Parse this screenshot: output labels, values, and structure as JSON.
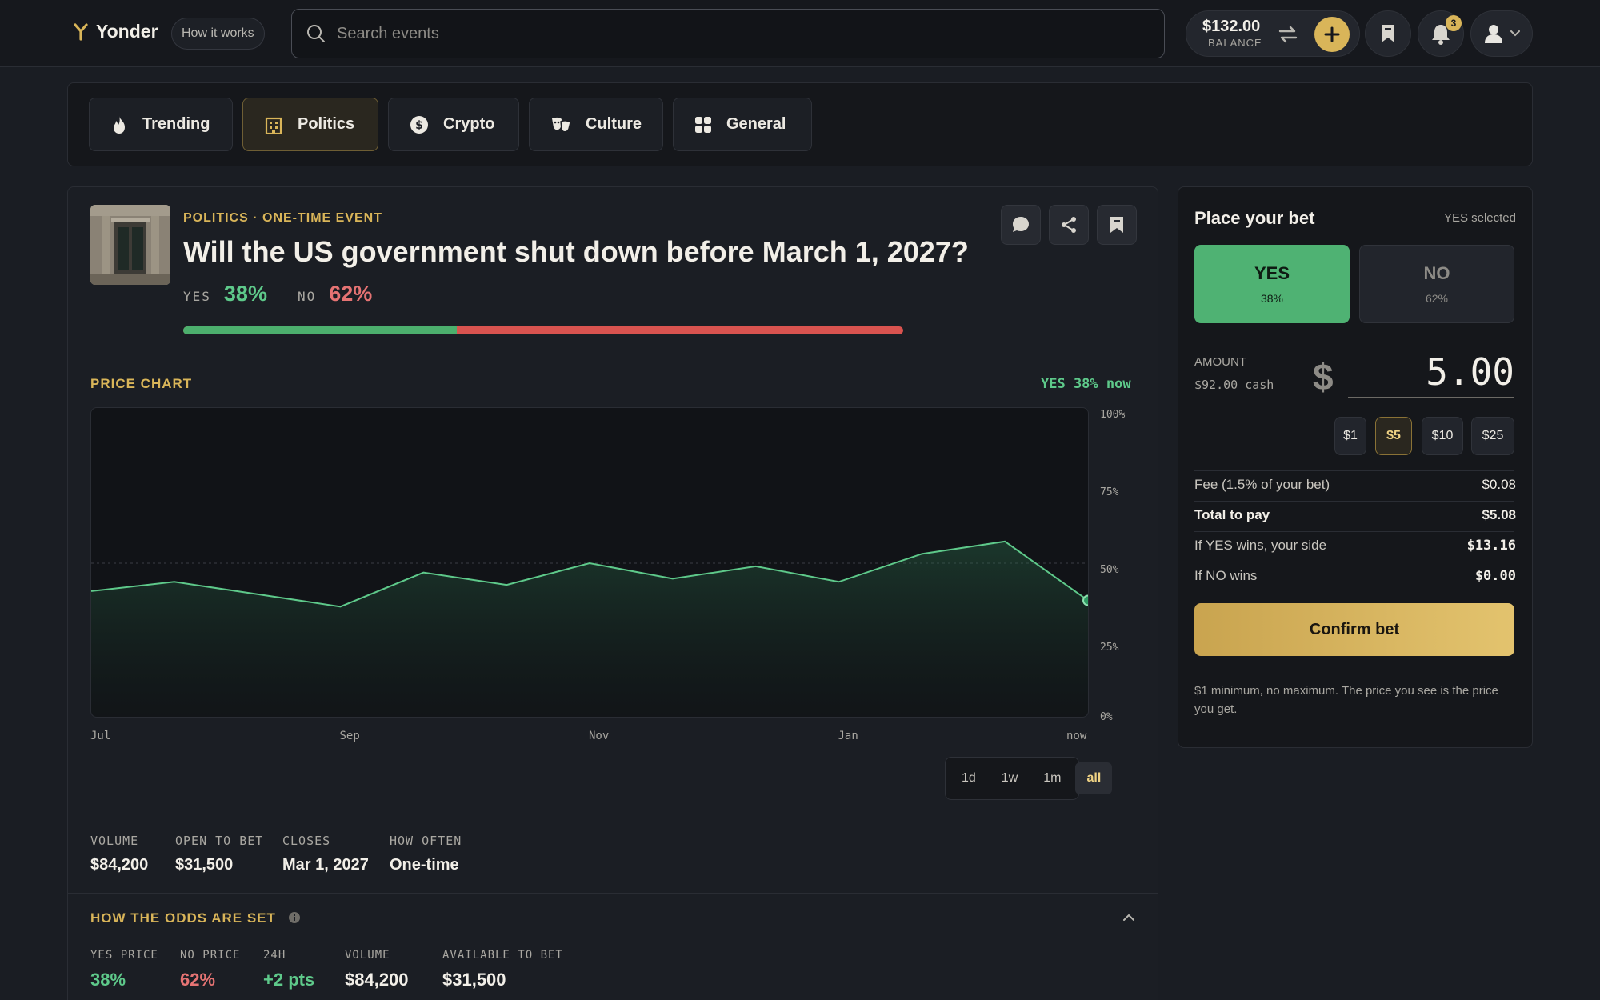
{
  "brand": {
    "name": "Yonder",
    "how_it_works": "How it works"
  },
  "search": {
    "placeholder": "Search events"
  },
  "account": {
    "balance": "$132.00",
    "balance_label": "BALANCE",
    "notifications": "3"
  },
  "categories": [
    {
      "label": "Trending",
      "icon": "flame-icon"
    },
    {
      "label": "Politics",
      "icon": "building-icon",
      "active": true
    },
    {
      "label": "Crypto",
      "icon": "coin-icon"
    },
    {
      "label": "Culture",
      "icon": "masks-icon"
    },
    {
      "label": "General",
      "icon": "grid-icon"
    }
  ],
  "event": {
    "kicker": "POLITICS · ONE-TIME EVENT",
    "question": "Will the US government shut down before March 1, 2027?",
    "yes_label": "YES",
    "yes_pct": "38%",
    "no_label": "NO",
    "no_pct": "62%",
    "yes_fraction": 0.38
  },
  "chart": {
    "heading": "PRICE CHART",
    "now_label": "YES 38% now",
    "range_options": [
      "1d",
      "1w",
      "1m",
      "all"
    ],
    "active_range": "all"
  },
  "chart_data": {
    "type": "area",
    "x": [
      "Jul",
      "",
      "",
      "Sep",
      "",
      "",
      "Nov",
      "",
      "",
      "Jan",
      "",
      "",
      "now"
    ],
    "xticks": [
      "Jul",
      "Sep",
      "Nov",
      "Jan",
      "now"
    ],
    "series": [
      {
        "values": [
          41,
          44,
          40,
          36,
          47,
          43,
          50,
          45,
          49,
          44,
          53,
          57,
          38
        ]
      }
    ],
    "ylim": [
      0,
      100
    ],
    "yticks": [
      "100%",
      "75%",
      "50%",
      "25%",
      "0%"
    ],
    "reference_line": 50,
    "color": "#5ec98a"
  },
  "stats": [
    {
      "label": "VOLUME",
      "value": "$84,200"
    },
    {
      "label": "OPEN TO BET",
      "value": "$31,500"
    },
    {
      "label": "CLOSES",
      "value": "Mar 1, 2027"
    },
    {
      "label": "HOW OFTEN",
      "value": "One-time"
    }
  ],
  "odds": {
    "heading": "HOW THE ODDS ARE SET",
    "items": [
      {
        "label": "YES PRICE",
        "value": "38%",
        "color": "#5ec98a"
      },
      {
        "label": "NO PRICE",
        "value": "62%",
        "color": "#e57373"
      },
      {
        "label": "24H",
        "value": "+2 pts",
        "color": "#5ec98a"
      },
      {
        "label": "VOLUME",
        "value": "$84,200",
        "color": "#f2efe8"
      },
      {
        "label": "AVAILABLE TO BET",
        "value": "$31,500",
        "color": "#f2efe8"
      }
    ]
  },
  "bet": {
    "title": "Place your bet",
    "selected": "YES selected",
    "yes_label": "YES",
    "yes_pct": "38%",
    "no_label": "NO",
    "no_pct": "62%",
    "amount_label": "AMOUNT",
    "cash": "$92.00 cash",
    "currency": "$",
    "amount": "5.00",
    "quick_amounts": [
      "$1",
      "$5",
      "$10",
      "$25"
    ],
    "active_quick": "$5",
    "rows": [
      {
        "label": "Fee (1.5% of your bet)",
        "value": "$0.08"
      },
      {
        "label": "Total to pay",
        "value": "$5.08"
      },
      {
        "label": "If YES wins, your side",
        "value": "$13.16"
      },
      {
        "label": "If NO wins",
        "value": "$0.00"
      }
    ],
    "confirm": "Confirm bet",
    "note": "$1 minimum, no maximum. The price you see is the price you get."
  },
  "colors": {
    "accent": "#d9b559",
    "yes": "#5ec98a",
    "no": "#e57373"
  }
}
